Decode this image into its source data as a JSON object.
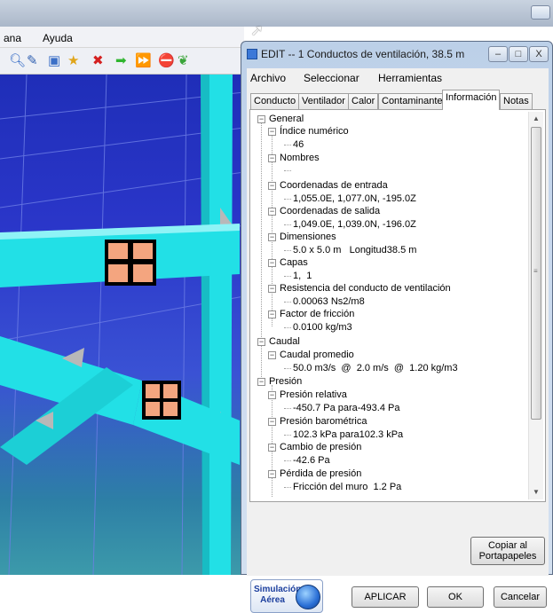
{
  "background_app": {
    "menu": [
      "ana",
      "Ayuda"
    ],
    "toolbar_icons": [
      "search-icon",
      "pencil-icon",
      "layers-icon",
      "star-icon",
      "delete-icon",
      "arrow-right-icon",
      "double-arrow-icon",
      "stop-icon",
      "node-icon"
    ]
  },
  "dialog": {
    "title": "EDIT -- 1 Conductos de ventilación, 38.5 m",
    "window_buttons": {
      "minimize": "–",
      "maximize": "□",
      "close": "X"
    },
    "menu": {
      "archivo": "Archivo",
      "seleccionar": "Seleccionar",
      "herramientas": "Herramientas"
    },
    "tabs": [
      "Conducto",
      "Ventilador",
      "Calor",
      "Contaminante",
      "Información",
      "Notas"
    ],
    "active_tab": "Información",
    "tree": {
      "general": "General",
      "indice": "Índice numérico",
      "indice_val": "46",
      "nombres": "Nombres",
      "coord_entrada": "Coordenadas de entrada",
      "coord_entrada_val": "1,055.0E, 1,077.0N, -195.0Z",
      "coord_salida": "Coordenadas de salida",
      "coord_salida_val": "1,049.0E, 1,039.0N, -196.0Z",
      "dimensiones": "Dimensiones",
      "dimensiones_val": "5.0 x 5.0 m   Longitud38.5 m",
      "capas": "Capas",
      "capas_val": "1,  1",
      "resistencia": "Resistencia del conducto de ventilación",
      "resistencia_val": "0.00063 Ns2/m8",
      "friccion": "Factor de fricción",
      "friccion_val": "0.0100 kg/m3",
      "caudal": "Caudal",
      "caudal_prom": "Caudal promedio",
      "caudal_prom_val": "50.0 m3/s  @  2.0 m/s  @  1.20 kg/m3",
      "presion": "Presión",
      "presion_rel": "Presión relativa",
      "presion_rel_val": "-450.7 Pa para-493.4 Pa",
      "presion_bar": "Presión barométrica",
      "presion_bar_val": "102.3 kPa para102.3 kPa",
      "cambio_presion": "Cambio de presión",
      "cambio_presion_val": "-42.6 Pa",
      "perdida_presion": "Pérdida de presión",
      "friccion_muro": "Fricción del muro  1.2 Pa"
    },
    "buttons": {
      "copiar_line1": "Copiar al",
      "copiar_line2": "Portapapeles",
      "sim_line1": "Simulación",
      "sim_line2": "Aérea",
      "aplicar": "APLICAR",
      "ok": "OK",
      "cancelar": "Cancelar"
    }
  }
}
